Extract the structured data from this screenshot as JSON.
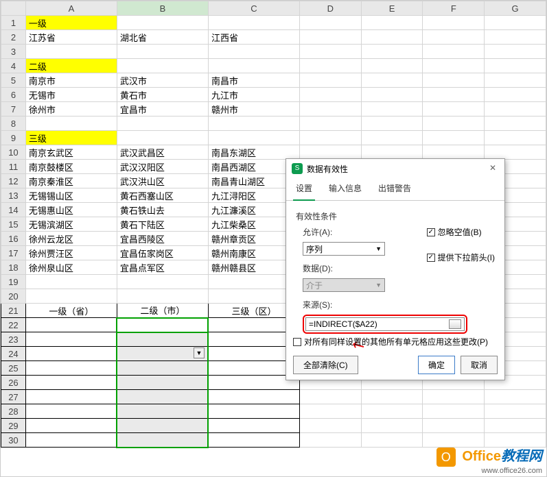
{
  "columns": [
    "",
    "A",
    "B",
    "C",
    "D",
    "E",
    "F",
    "G"
  ],
  "rows": {
    "r1": {
      "A": "一级"
    },
    "r2": {
      "A": "江苏省",
      "B": "湖北省",
      "C": "江西省"
    },
    "r4": {
      "A": "二级"
    },
    "r5": {
      "A": "南京市",
      "B": "武汉市",
      "C": "南昌市"
    },
    "r6": {
      "A": "无锡市",
      "B": "黄石市",
      "C": "九江市"
    },
    "r7": {
      "A": "徐州市",
      "B": "宜昌市",
      "C": "赣州市"
    },
    "r9": {
      "A": "三级"
    },
    "r10": {
      "A": "南京玄武区",
      "B": "武汉武昌区",
      "C": "南昌东湖区"
    },
    "r11": {
      "A": "南京鼓楼区",
      "B": "武汉汉阳区",
      "C": "南昌西湖区"
    },
    "r12": {
      "A": "南京秦淮区",
      "B": "武汉洪山区",
      "C": "南昌青山湖区"
    },
    "r13": {
      "A": "无锡锡山区",
      "B": "黄石西塞山区",
      "C": "九江浔阳区"
    },
    "r14": {
      "A": "无锡惠山区",
      "B": "黄石铁山去",
      "C": "九江濂溪区"
    },
    "r15": {
      "A": "无锡滨湖区",
      "B": "黄石下陆区",
      "C": "九江柴桑区"
    },
    "r16": {
      "A": "徐州云龙区",
      "B": "宜昌西陵区",
      "C": "赣州章贡区"
    },
    "r17": {
      "A": "徐州贾汪区",
      "B": "宜昌伍家岗区",
      "C": "赣州南康区"
    },
    "r18": {
      "A": "徐州泉山区",
      "B": "宜昌点军区",
      "C": "赣州赣县区"
    },
    "r21": {
      "A": "一级（省）",
      "B": "二级（市）",
      "C": "三级（区）"
    }
  },
  "dialog": {
    "title": "数据有效性",
    "tabs": {
      "settings": "设置",
      "input": "输入信息",
      "error": "出错警告"
    },
    "cond_header": "有效性条件",
    "allow_label": "允许(A):",
    "allow_value": "序列",
    "data_label": "数据(D):",
    "data_value": "介于",
    "source_label": "来源(S):",
    "source_value": "=INDIRECT($A22)",
    "ignore_blank": "忽略空值(B)",
    "dropdown_arrow": "提供下拉箭头(I)",
    "apply_all": "对所有同样设置的其他所有单元格应用这些更改(P)",
    "clear_all": "全部清除(C)",
    "ok": "确定",
    "cancel": "取消"
  },
  "watermark": {
    "brand": "Office",
    "suffix": "教程网",
    "url": "www.office26.com"
  }
}
